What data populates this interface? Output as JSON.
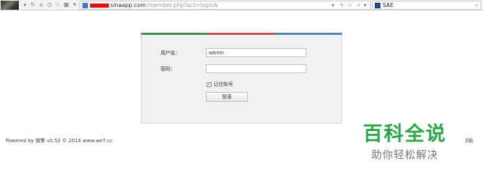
{
  "browser": {
    "nav_icons": [
      "back-icon",
      "reload-icon",
      "home-icon",
      "history-icon",
      "favorite-icon",
      "grid-icon"
    ],
    "url_host": "sinaapp.com",
    "url_path": "/member.php?act=login&",
    "url_right_icons": [
      "dropdown-icon",
      "lightning-icon",
      "star-icon",
      "check-icon",
      "menu-arrow-icon"
    ],
    "search_engine": "SAE",
    "search_button_icon": "search-icon"
  },
  "login": {
    "stripe_colors": [
      "#3f8f4a",
      "#c0504d",
      "#4f81bd"
    ],
    "username_label": "用户名：",
    "username_value": "admin",
    "password_label": "密码：",
    "password_value": "",
    "remember_label": "记住账号",
    "remember_checked": true,
    "submit_label": "登录"
  },
  "footer": {
    "left": "Powered by 微擎 v0.52 © 2014 www.we7.cc",
    "right": "帮助"
  },
  "watermark": {
    "title": "百科全说",
    "subtitle": "助你轻松解决",
    "color": "#27a844"
  }
}
